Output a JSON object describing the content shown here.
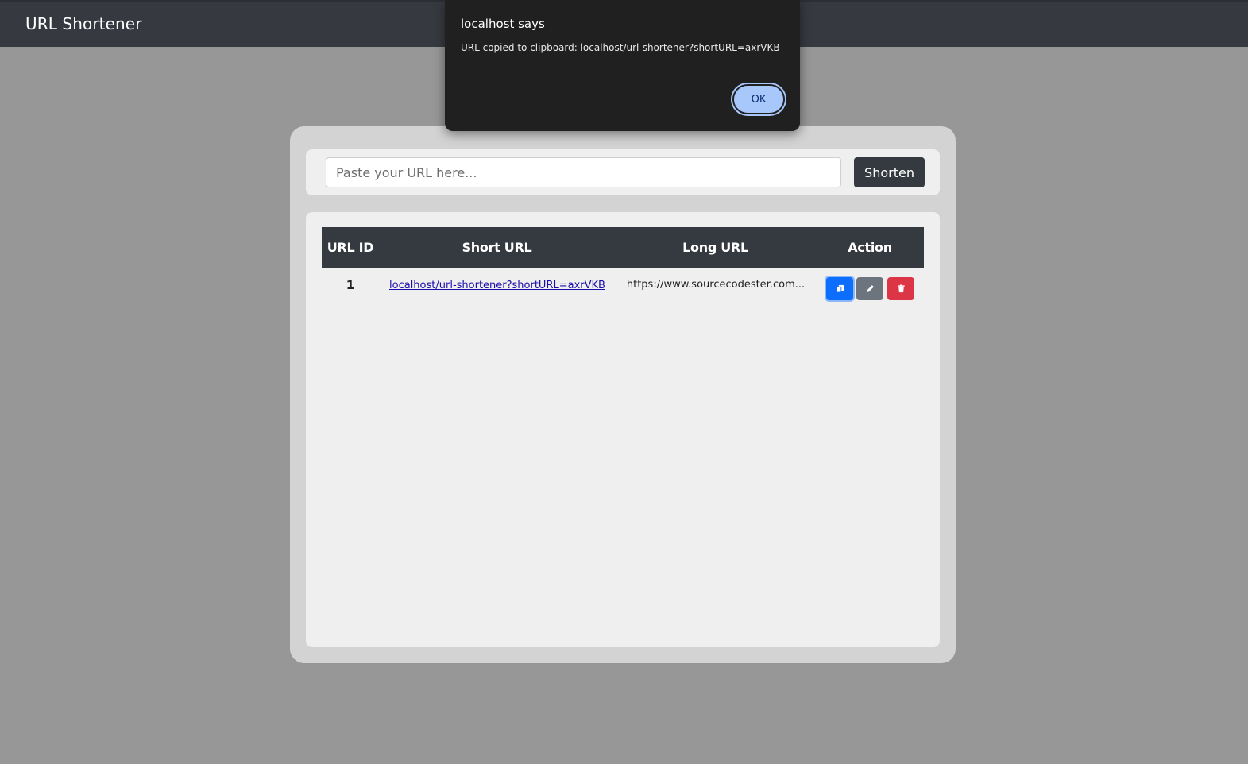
{
  "header": {
    "title": "URL Shortener"
  },
  "form": {
    "placeholder": "Paste your URL here...",
    "submit_label": "Shorten"
  },
  "table": {
    "columns": [
      "URL ID",
      "Short URL",
      "Long URL",
      "Action"
    ],
    "rows": [
      {
        "id": "1",
        "short_url": "localhost/url-shortener?shortURL=axrVKB",
        "long_url": "https://www.sourcecodester.com...",
        "actions": [
          "copy-icon",
          "pencil-icon",
          "trash-icon"
        ]
      }
    ]
  },
  "dialog": {
    "title": "localhost says",
    "message": "URL copied to clipboard: localhost/url-shortener?shortURL=axrVKB",
    "ok_label": "OK"
  },
  "colors": {
    "navbar": "#363a40",
    "page_bg": "#979797",
    "copy_button": "#0d6efd",
    "edit_button": "#6c757d",
    "delete_button": "#dc3545",
    "dialog_bg": "#202020",
    "dialog_ok": "#a8c7fa"
  }
}
